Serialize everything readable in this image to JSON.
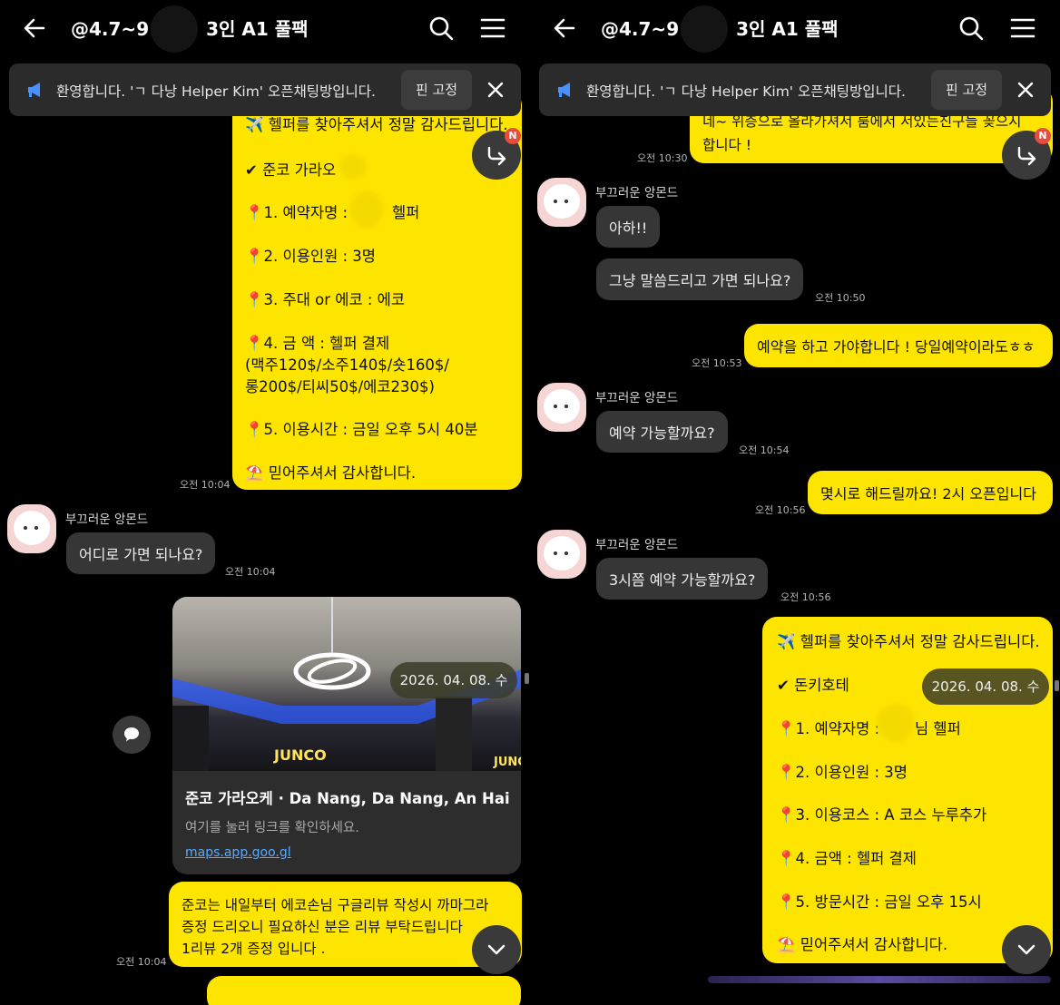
{
  "panels": [
    {
      "title": "@4.7~9 ",
      "title_suffix": "3인 A1 풀팩",
      "notice": {
        "text": "환영합니다. 'ㄱ 다낭 Helper Kim' 오픈채팅방입니다.",
        "pin_label": "핀 고정"
      },
      "res_card": {
        "top_line": "✈️ 헬퍼를 찾아주셔서 정말 감사드립니다.",
        "lines": [
          "✔ 준코 가라오",
          "📍1. 예약자명 :",
          "헬퍼",
          "📍2. 이용인원 :  3명",
          "📍3. 주대 or 에코 :  에코",
          "📍4. 금 액 : 헬퍼 결제",
          "(맥주120$/소주140$/숏160$/",
          "롱200$/티씨50$/에코230$)",
          "📍5. 이용시간 : 금일 오후 5시 40분",
          "⛱️ 믿어주셔서 감사합니다."
        ],
        "time": "오전 10:04"
      },
      "sender": "부끄러운 앙몬드",
      "incoming": {
        "text": "어디로 가면 되나요?",
        "time": "오전 10:04"
      },
      "date_pill": "2026. 04. 08. 수",
      "badge": "N",
      "link_card": {
        "title": "준코 가라오케 · Da Nang, Da Nang, An Hai",
        "subtitle": "여기를 눌러 링크를 확인하세요.",
        "link": "maps.app.goo.gl"
      },
      "review_msg": {
        "lines": [
          "준코는 내일부터 에코손님 구글리뷰 작성시 까마그라",
          "증정 드리오니 필요하신 분은 리뷰 부탁드립니다",
          "1리뷰 2개 증정 입니다 ."
        ],
        "time": "오전 10:04"
      }
    },
    {
      "title": "@4.7~9 ",
      "title_suffix": "3인 A1 풀팩",
      "notice": {
        "text": "환영합니다. 'ㄱ 다낭 Helper Kim' 오픈채팅방입니다.",
        "pin_label": "핀 고정"
      },
      "top_partial": {
        "lines": [
          "네~ 위층으로 올라가셔서 룸에서 서있는친구들 꽂으시",
          "합니다 !"
        ],
        "time": "오전 10:30"
      },
      "sender": "부끄러운 앙몬드",
      "incoming1": [
        {
          "text": "아하!!",
          "time": ""
        },
        {
          "text": "그냥 말씀드리고 가면 되나요?",
          "time": "오전 10:50"
        }
      ],
      "out1": {
        "text": "예약을 하고 가야합니다 ! 당일예약이라도ㅎㅎ",
        "time": "오전 10:53"
      },
      "incoming2": {
        "text": "예약 가능할까요?",
        "time": "오전 10:54"
      },
      "out2": {
        "text": "몇시로 해드릴까요! 2시 오픈입니다",
        "time": "오전 10:56"
      },
      "incoming3": {
        "text": "3시쯤 예약 가능할까요?",
        "time": "오전 10:56"
      },
      "res_card2": {
        "lines": [
          "✈️ 헬퍼를 찾아주셔서 정말 감사드립니다.",
          "✔ 돈키호테",
          "📍1. 예약자명 :",
          "님 헬퍼",
          "📍2. 이용인원 :  3명",
          "📍3. 이용코스 :  A 코스 누루추가",
          "📍4. 금액 : 헬퍼 결제",
          "📍5. 방문시간 : 금일 오후 15시",
          "⛱️ 믿어주셔서 감사합니다."
        ]
      },
      "date_pill": "2026. 04. 08. 수",
      "badge": "N"
    }
  ],
  "icons": [
    "back-arrow-icon",
    "search-icon",
    "menu-icon",
    "megaphone-icon",
    "close-icon",
    "share-icon",
    "chevron-down-icon",
    "comment-icon"
  ],
  "colors": {
    "background": "#000000",
    "my_bubble": "#fee500",
    "other_bubble": "#363636",
    "notice_bg": "#2b2b2b",
    "link": "#5aa9ff",
    "badge": "#e74c3c"
  }
}
